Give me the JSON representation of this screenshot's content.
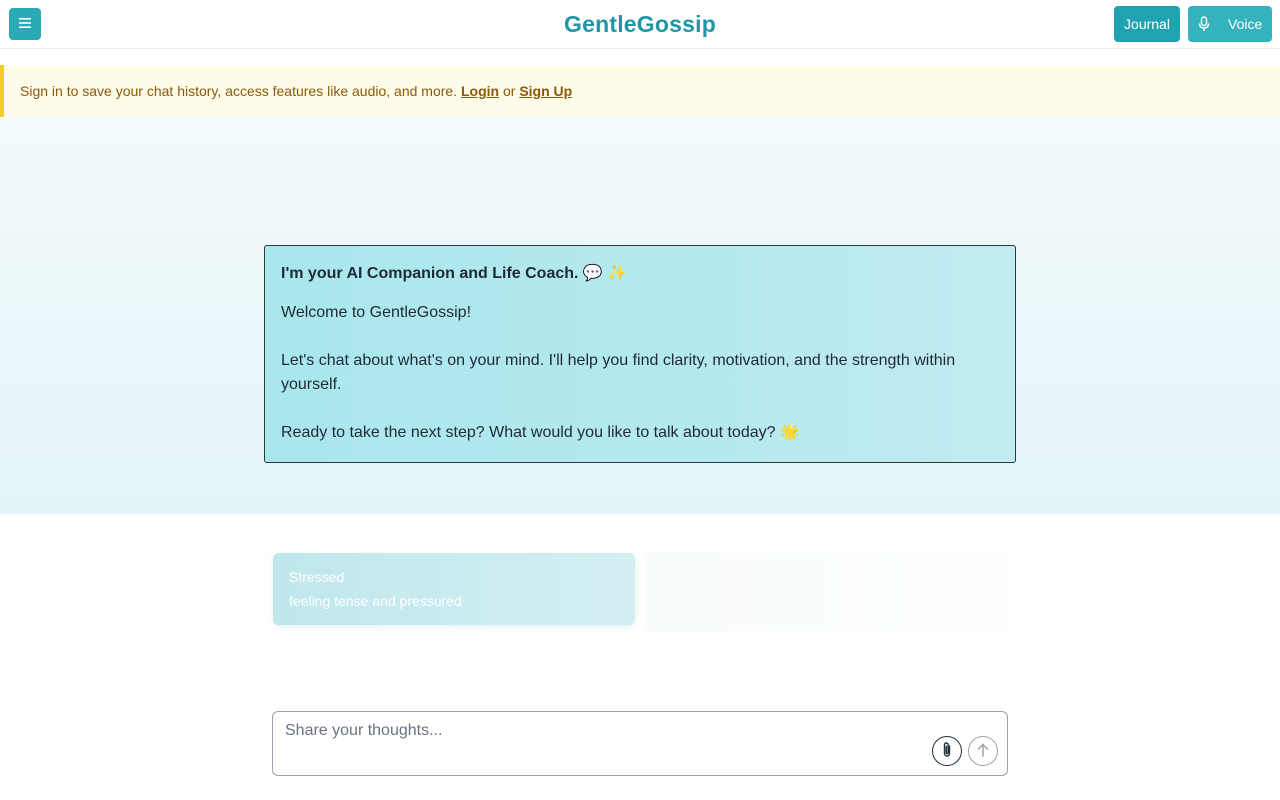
{
  "header": {
    "brand": "GentleGossip",
    "menu_icon": "menu-icon",
    "journal_label": "Journal",
    "voice_label": "Voice",
    "voice_icon": "microphone-icon",
    "accent": "#1fa3b0"
  },
  "banner": {
    "text": "Sign in to save your chat history, access features like audio, and more.",
    "login_label": "Login",
    "or_text": "or",
    "signup_label": "Sign Up",
    "accent": "#f4cc2c"
  },
  "welcome": {
    "title": "I'm your AI Companion and Life Coach. 💬 ✨",
    "line1": "Welcome to GentleGossip!",
    "line2": "Let's chat about what's on your mind. I'll help you find clarity, motivation, and the strength within yourself.",
    "line3": "Ready to take the next step? What would you like to talk about today? 🌟"
  },
  "suggestions": [
    {
      "title": "Stressed",
      "subtitle": "feeling tense and pressured"
    }
  ],
  "composer": {
    "placeholder": "Share your thoughts...",
    "attach_icon": "paperclip-icon",
    "send_icon": "arrow-up-icon"
  }
}
